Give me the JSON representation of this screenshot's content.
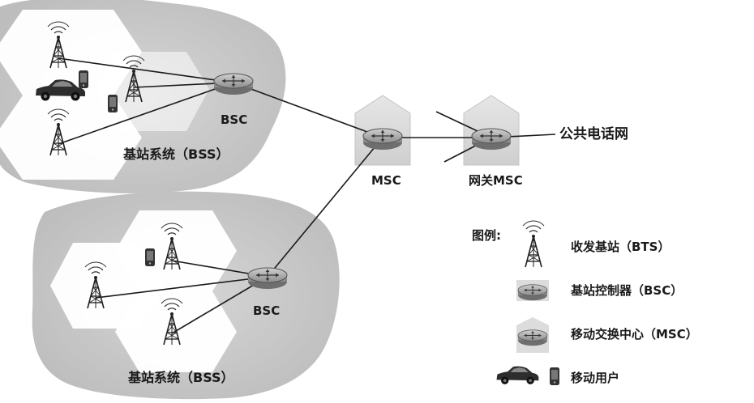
{
  "bss_labels": [
    "基站系统（BSS）",
    "基站系统（BSS）"
  ],
  "bsc_label": "BSC",
  "msc_label": "MSC",
  "gateway_msc_label": "网关MSC",
  "pstn_label": "公共电话网",
  "legend": {
    "title": "图例:",
    "items": [
      {
        "icon": "antenna-tower-icon",
        "label": "收发基站（BTS）"
      },
      {
        "icon": "router-icon",
        "label": "基站控制器（BSC）"
      },
      {
        "icon": "router-building-icon",
        "label": "移动交换中心（MSC）"
      },
      {
        "icon": "car-phone-icon",
        "label": "移动用户"
      }
    ]
  },
  "colors": {
    "cloud": "#c9c9c9",
    "hexagon": "#ffffff",
    "building": "#dcdcdc",
    "router": "#a8a8a8",
    "line": "#1a1a1a"
  }
}
